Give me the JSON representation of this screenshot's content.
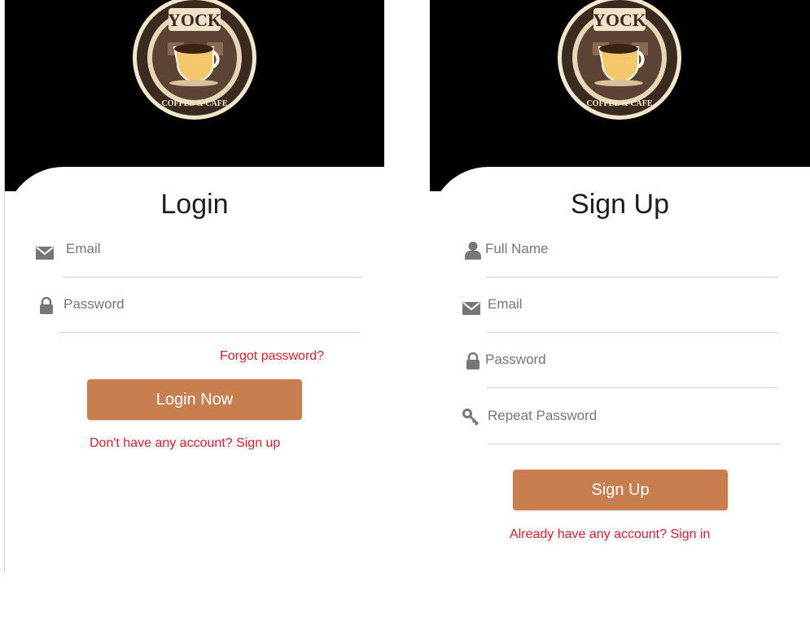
{
  "brand": {
    "logo_name": "YOCK",
    "logo_ring_text": "COFFEE & CAFE",
    "colors": {
      "header": "#000000",
      "accent": "#c97e4f",
      "link": "#e3192c"
    }
  },
  "login": {
    "title": "Login",
    "email_placeholder": "Email",
    "password_placeholder": "Password",
    "forgot_password": "Forgot password?",
    "submit_label": "Login Now",
    "signup_link": "Don't have any account? Sign up"
  },
  "signup": {
    "title": "Sign Up",
    "fullname_placeholder": "Full Name",
    "email_placeholder": "Email",
    "password_placeholder": "Password",
    "repeat_password_placeholder": "Repeat Password",
    "submit_label": "Sign Up",
    "signin_link": "Already have any account? Sign in"
  },
  "icons": {
    "email": "envelope-icon",
    "password": "lock-icon",
    "fullname": "user-icon",
    "repeat_password": "key-icon"
  }
}
